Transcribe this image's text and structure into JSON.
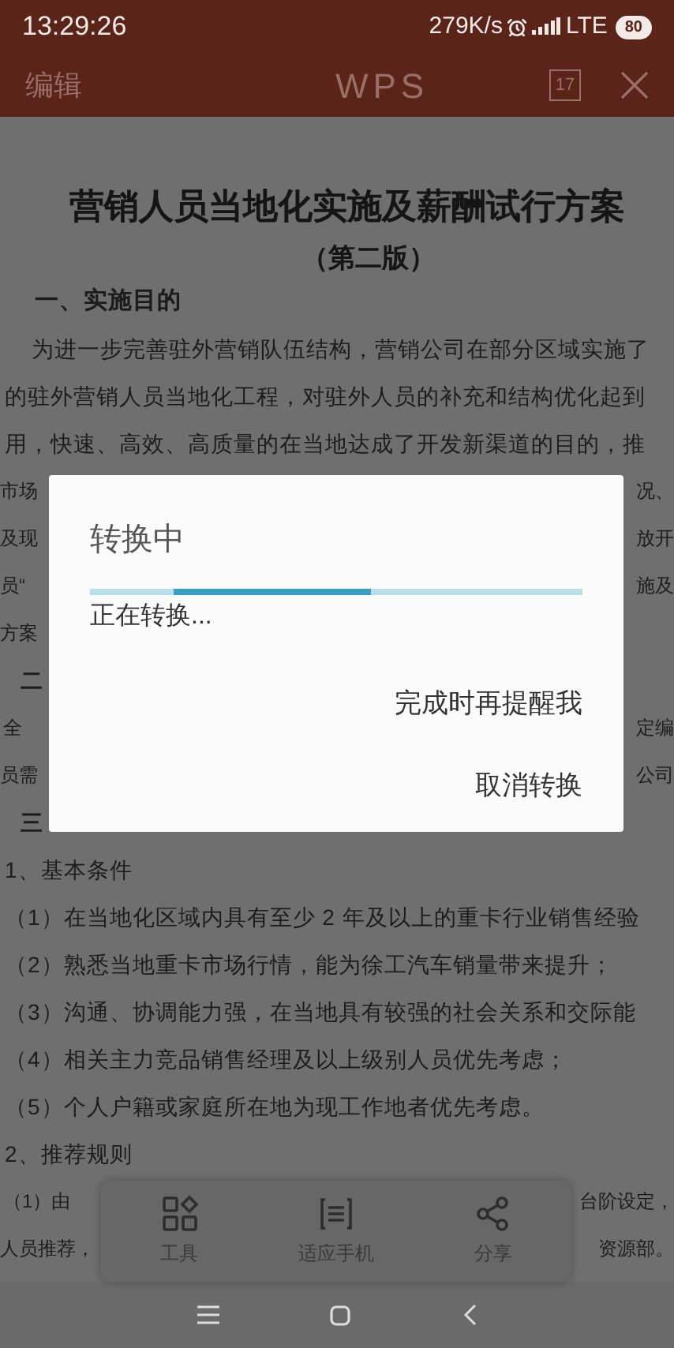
{
  "status_bar": {
    "time": "13:29:26",
    "speed": "279K/s",
    "network": "LTE",
    "battery": "80"
  },
  "top_bar": {
    "edit": "编辑",
    "logo": "WPS",
    "page_badge": "17"
  },
  "document": {
    "title": "营销人员当地化实施及薪酬试行方案",
    "subtitle": "（第二版）",
    "lines": [
      {
        "kind": "heading",
        "text": "一、实施目的"
      },
      {
        "kind": "indent",
        "text": "为进一步完善驻外营销队伍结构，营销公司在部分区域实施了"
      },
      {
        "kind": "plain",
        "text": "的驻外营销人员当地化工程，对驻外人员的补充和结构优化起到"
      },
      {
        "kind": "plain",
        "text": "用，快速、高效、高质量的在当地达成了开发新渠道的目的，推"
      },
      {
        "kind": "split",
        "left": "市场",
        "right": "况、"
      },
      {
        "kind": "split",
        "left": "及现",
        "right": "放开"
      },
      {
        "kind": "split",
        "left": "员“",
        "right": "施及"
      },
      {
        "kind": "split",
        "left": "方案"
      },
      {
        "kind": "split_heading",
        "left": "二"
      },
      {
        "kind": "split_indent",
        "left": "全",
        "right": "定编"
      },
      {
        "kind": "split",
        "left": "员需",
        "right": "公司"
      },
      {
        "kind": "split_heading",
        "left": "三"
      },
      {
        "kind": "plain",
        "text": "1、基本条件"
      },
      {
        "kind": "plain",
        "text": "（1）在当地化区域内具有至少 2 年及以上的重卡行业销售经验"
      },
      {
        "kind": "plain",
        "text": "（2）熟悉当地重卡市场行情，能为徐工汽车销量带来提升；"
      },
      {
        "kind": "plain",
        "text": "（3）沟通、协调能力强，在当地具有较强的社会关系和交际能"
      },
      {
        "kind": "plain",
        "text": "（4）相关主力竞品销售经理及以上级别人员优先考虑；"
      },
      {
        "kind": "plain",
        "text": "（5）个人户籍或家庭所在地为现工作地者优先考虑。"
      },
      {
        "kind": "plain",
        "text": "2、推荐规则"
      },
      {
        "kind": "split_indent",
        "left": "（1）由",
        "right": "台阶设定，"
      },
      {
        "kind": "split",
        "left": "人员推荐，",
        "right": "资源部。"
      }
    ]
  },
  "dialog": {
    "title": "转换中",
    "message": "正在转换...",
    "progress": {
      "level": 0.4
    },
    "actions": [
      {
        "label": "完成时再提醒我"
      },
      {
        "label": "取消转换"
      }
    ]
  },
  "toolbar": [
    {
      "kind": "tools",
      "label": "工具"
    },
    {
      "kind": "fit",
      "label": "适应手机"
    },
    {
      "kind": "share",
      "label": "分享"
    }
  ]
}
